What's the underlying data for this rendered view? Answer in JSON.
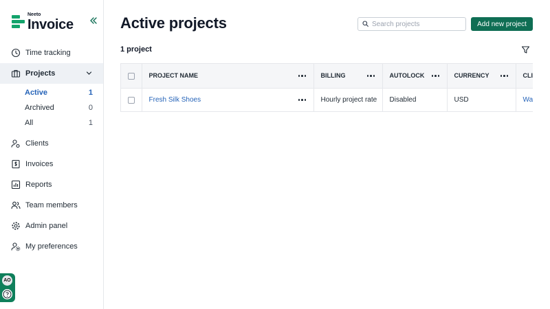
{
  "brand": {
    "small": "Neeto",
    "big": "Invoice",
    "color": "#12a36b"
  },
  "sidebar": {
    "items": [
      {
        "label": "Time tracking",
        "icon": "clock-icon"
      },
      {
        "label": "Projects",
        "icon": "briefcase-icon",
        "active": true
      },
      {
        "label": "Clients",
        "icon": "user-gear-icon"
      },
      {
        "label": "Invoices",
        "icon": "dollar-doc-icon"
      },
      {
        "label": "Reports",
        "icon": "bar-chart-icon"
      },
      {
        "label": "Team members",
        "icon": "users-icon"
      },
      {
        "label": "Admin panel",
        "icon": "gear-icon"
      },
      {
        "label": "My preferences",
        "icon": "user-settings-icon"
      }
    ],
    "projects_sub": [
      {
        "label": "Active",
        "count": "1",
        "active": true
      },
      {
        "label": "Archived",
        "count": "0"
      },
      {
        "label": "All",
        "count": "1"
      }
    ],
    "user_initials": "AO"
  },
  "header": {
    "title": "Active projects",
    "search_placeholder": "Search projects",
    "add_label": "Add new project"
  },
  "count_label": "1 project",
  "table": {
    "columns": [
      "PROJECT NAME",
      "BILLING",
      "AUTOLOCK",
      "CURRENCY",
      "CLI"
    ],
    "rows": [
      {
        "name": "Fresh Silk Shoes",
        "billing": "Hourly project rate",
        "autolock": "Disabled",
        "currency": "USD",
        "client": "Wa"
      }
    ]
  },
  "colors": {
    "accent": "#0f6e54",
    "link": "#2563b8",
    "active_bg": "#eef1f5"
  }
}
